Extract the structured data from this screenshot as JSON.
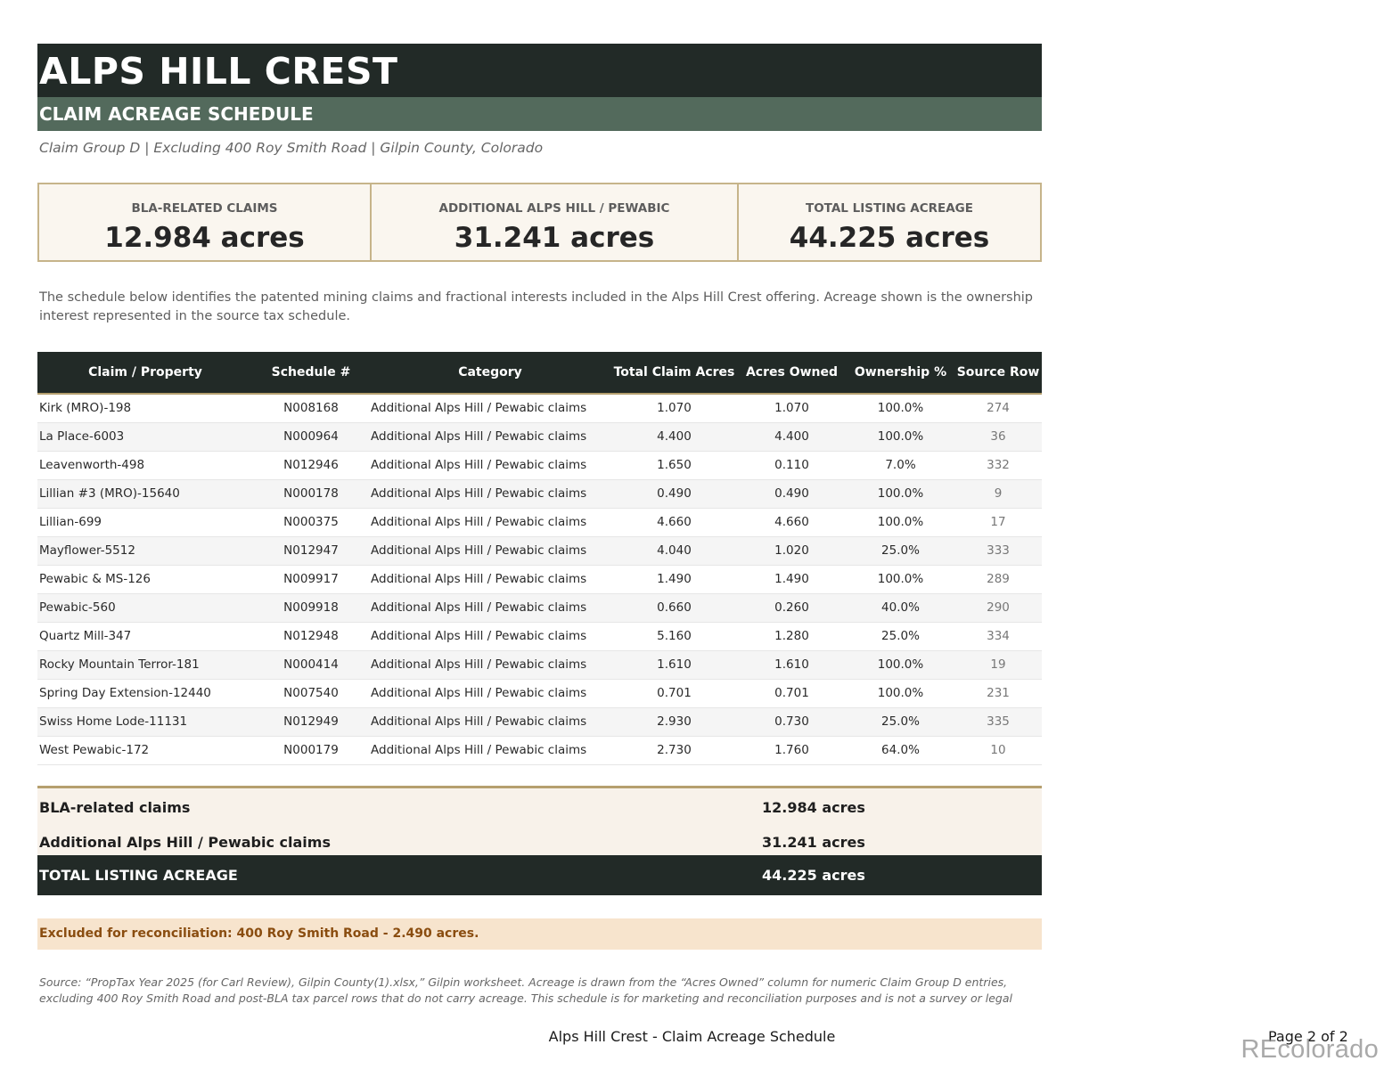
{
  "header": {
    "title": "ALPS HILL CREST",
    "subtitle": "CLAIM ACREAGE SCHEDULE",
    "tagline": "Claim Group D | Excluding 400 Roy Smith Road | Gilpin County, Colorado"
  },
  "stats": [
    {
      "label": "BLA-RELATED CLAIMS",
      "value": "12.984 acres"
    },
    {
      "label": "ADDITIONAL ALPS HILL / PEWABIC",
      "value": "31.241 acres"
    },
    {
      "label": "TOTAL LISTING ACREAGE",
      "value": "44.225 acres"
    }
  ],
  "intro": "The schedule below identifies the patented mining claims and fractional interests included in the Alps Hill Crest offering. Acreage shown is the ownership interest represented in the source tax schedule.",
  "table": {
    "columns": [
      "Claim / Property",
      "Schedule #",
      "Category",
      "Total Claim Acres",
      "Acres Owned",
      "Ownership %",
      "Source Row"
    ],
    "rows": [
      [
        "Kirk (MRO)-198",
        "N008168",
        "Additional Alps Hill / Pewabic claims",
        "1.070",
        "1.070",
        "100.0%",
        "274"
      ],
      [
        "La Place-6003",
        "N000964",
        "Additional Alps Hill / Pewabic claims",
        "4.400",
        "4.400",
        "100.0%",
        "36"
      ],
      [
        "Leavenworth-498",
        "N012946",
        "Additional Alps Hill / Pewabic claims",
        "1.650",
        "0.110",
        "7.0%",
        "332"
      ],
      [
        "Lillian #3 (MRO)-15640",
        "N000178",
        "Additional Alps Hill / Pewabic claims",
        "0.490",
        "0.490",
        "100.0%",
        "9"
      ],
      [
        "Lillian-699",
        "N000375",
        "Additional Alps Hill / Pewabic claims",
        "4.660",
        "4.660",
        "100.0%",
        "17"
      ],
      [
        "Mayflower-5512",
        "N012947",
        "Additional Alps Hill / Pewabic claims",
        "4.040",
        "1.020",
        "25.0%",
        "333"
      ],
      [
        "Pewabic & MS-126",
        "N009917",
        "Additional Alps Hill / Pewabic claims",
        "1.490",
        "1.490",
        "100.0%",
        "289"
      ],
      [
        "Pewabic-560",
        "N009918",
        "Additional Alps Hill / Pewabic claims",
        "0.660",
        "0.260",
        "40.0%",
        "290"
      ],
      [
        "Quartz Mill-347",
        "N012948",
        "Additional Alps Hill / Pewabic claims",
        "5.160",
        "1.280",
        "25.0%",
        "334"
      ],
      [
        "Rocky Mountain Terror-181",
        "N000414",
        "Additional Alps Hill / Pewabic claims",
        "1.610",
        "1.610",
        "100.0%",
        "19"
      ],
      [
        "Spring Day Extension-12440",
        "N007540",
        "Additional Alps Hill / Pewabic claims",
        "0.701",
        "0.701",
        "100.0%",
        "231"
      ],
      [
        "Swiss Home Lode-11131",
        "N012949",
        "Additional Alps Hill / Pewabic claims",
        "2.930",
        "0.730",
        "25.0%",
        "335"
      ],
      [
        "West Pewabic-172",
        "N000179",
        "Additional Alps Hill / Pewabic claims",
        "2.730",
        "1.760",
        "64.0%",
        "10"
      ]
    ]
  },
  "summary": {
    "rows": [
      {
        "label": "BLA-related claims",
        "value": "12.984 acres"
      },
      {
        "label": "Additional Alps Hill / Pewabic claims",
        "value": "31.241 acres"
      }
    ],
    "total_label": "TOTAL LISTING ACREAGE",
    "total_value": "44.225 acres"
  },
  "note": "Excluded for reconciliation: 400 Roy Smith Road - 2.490 acres.",
  "source": "Source: “PropTax Year 2025 (for Carl Review), Gilpin County(1).xlsx,” Gilpin worksheet. Acreage is drawn from the “Acres Owned” column for numeric Claim Group D entries, excluding 400 Roy Smith Road and post-BLA tax parcel rows that do not carry acreage. This schedule is for marketing and reconciliation purposes and is not a survey or legal description.",
  "footer": {
    "center": "Alps Hill Crest - Claim Acreage Schedule",
    "page": "Page 2 of 2"
  },
  "watermark": "REcolorado"
}
